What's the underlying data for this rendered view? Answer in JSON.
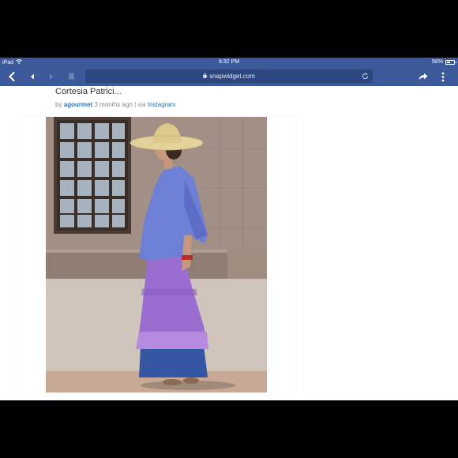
{
  "status_bar": {
    "device": "iPad",
    "time": "8:32 PM",
    "battery_percent": "56%",
    "battery_level": 0.56
  },
  "toolbar": {
    "url": "snapwidget.com"
  },
  "post": {
    "title": "Cortesia Patrici...",
    "by_prefix": "by",
    "author": "agourmet",
    "age": "3 months ago",
    "separator": "| via",
    "source": "Instagram"
  },
  "colors": {
    "chrome_blue": "#3c5a99",
    "url_bar": "#2c4680",
    "link_blue": "#2f72b8"
  }
}
